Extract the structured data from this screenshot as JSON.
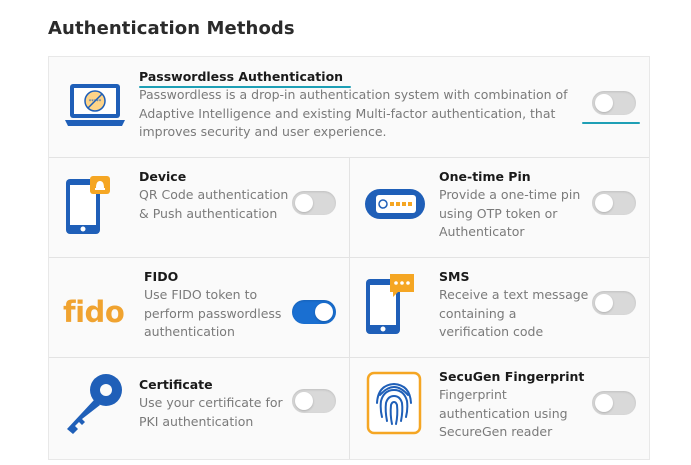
{
  "page": {
    "title": "Authentication Methods"
  },
  "methods": {
    "passwordless": {
      "label": "Passwordless Authentication",
      "desc": "Passwordless is a drop-in authentication system with combination of Adaptive Intelligence and existing Multi-factor authentication, that improves security and user experience.",
      "enabled": false
    },
    "device": {
      "label": "Device",
      "desc": "QR Code authentication & Push authentication",
      "enabled": false
    },
    "otp": {
      "label": "One-time Pin",
      "desc": "Provide a one-time pin using OTP token or Authenticator",
      "enabled": false
    },
    "fido": {
      "label": "FIDO",
      "desc": "Use FIDO token to perform passwordless authentication",
      "enabled": true,
      "logo_text": "fido"
    },
    "sms": {
      "label": "SMS",
      "desc": "Receive a text message containing a verification code",
      "enabled": false
    },
    "certificate": {
      "label": "Certificate",
      "desc": "Use your certificate for PKI authentication",
      "enabled": false
    },
    "fingerprint": {
      "label": "SecuGen Fingerprint",
      "desc": "Fingerprint authentication using SecureGen reader",
      "enabled": false
    }
  },
  "colors": {
    "accent": "#1a6fd1",
    "underline": "#1e9fb5",
    "icon_orange": "#f5a623",
    "fido_orange": "#f0a330"
  }
}
